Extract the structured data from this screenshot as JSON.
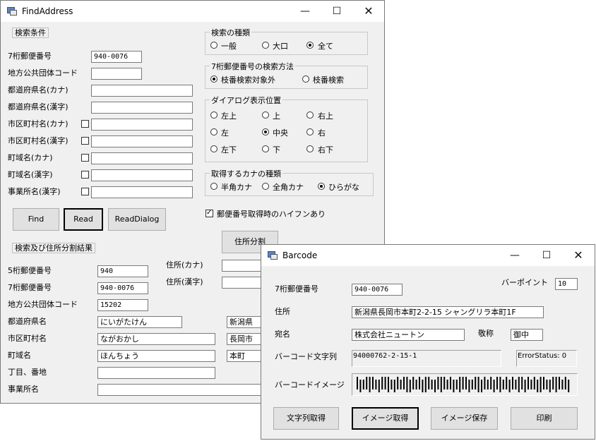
{
  "find": {
    "title": "FindAddress",
    "search_group": "検索条件",
    "labels": {
      "zip7": "7桁郵便番号",
      "local_code": "地方公共団体コード",
      "pref_kana": "都道府県名(カナ)",
      "pref_kanji": "都道府県名(漢字)",
      "city_kana": "市区町村名(カナ)",
      "city_kanji": "市区町村名(漢字)",
      "town_kana": "町域名(カナ)",
      "town_kanji": "町域名(漢字)",
      "office_kanji": "事業所名(漢字)"
    },
    "values": {
      "zip7": "940-0076"
    },
    "search_type": {
      "title": "検索の種類",
      "opt1": "一般",
      "opt2": "大口",
      "opt3": "全て"
    },
    "branch": {
      "title": "7桁郵便番号の検索方法",
      "opt1": "枝番検索対象外",
      "opt2": "枝番検索"
    },
    "dialog_pos": {
      "title": "ダイアログ表示位置",
      "tl": "左上",
      "tc": "上",
      "tr": "右上",
      "ml": "左",
      "mc": "中央",
      "mr": "右",
      "bl": "左下",
      "bc": "下",
      "br": "右下"
    },
    "kana_type": {
      "title": "取得するカナの種類",
      "opt1": "半角カナ",
      "opt2": "全角カナ",
      "opt3": "ひらがな"
    },
    "hyphen_label": "郵便番号取得時のハイフンあり",
    "buttons": {
      "find": "Find",
      "read": "Read",
      "read_dialog": "ReadDialog",
      "split": "住所分割"
    },
    "result_group": "検索及び住所分割結果",
    "result_labels": {
      "zip5": "5桁郵便番号",
      "zip7": "7桁郵便番号",
      "local_code": "地方公共団体コード",
      "pref": "都道府県名",
      "city": "市区町村名",
      "town": "町域名",
      "chome": "丁目、番地",
      "office": "事業所名",
      "addr_kana": "住所(カナ)",
      "addr_kanji": "住所(漢字)"
    },
    "result_values": {
      "zip5": "940",
      "zip7": "940-0076",
      "local_code": "15202",
      "pref_kana": "にいがたけん",
      "pref_kanji": "新潟県",
      "city_kana": "ながおかし",
      "city_kanji": "長岡市",
      "town_kana": "ほんちょう",
      "town_kanji": "本町"
    }
  },
  "barcode": {
    "title": "Barcode",
    "labels": {
      "zip7": "7桁郵便番号",
      "point": "バーポイント",
      "address": "住所",
      "recipient": "宛名",
      "honorific": "敬称",
      "barcode_str": "バーコード文字列",
      "barcode_img": "バーコードイメージ"
    },
    "values": {
      "zip7": "940-0076",
      "point": "10",
      "address": "新潟県長岡市本町2-2-15 シャングリラ本町1F",
      "recipient": "株式会社ニュートン",
      "honorific": "御中",
      "barcode_str": "94000762-2-15-1",
      "error_status": "ErrorStatus: 0"
    },
    "buttons": {
      "get_string": "文字列取得",
      "get_image": "イメージ取得",
      "save_image": "イメージ保存",
      "print": "印刷"
    }
  }
}
